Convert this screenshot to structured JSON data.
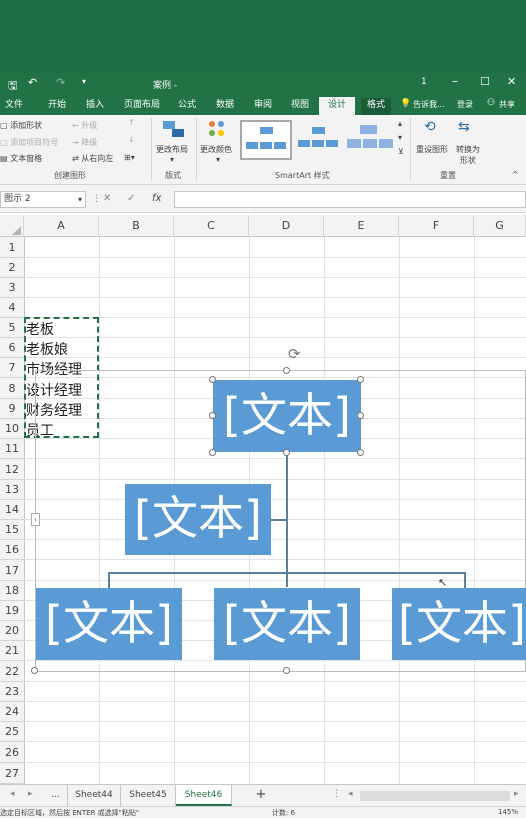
{
  "title_bar": {
    "save_icon": "save-icon",
    "undo_icon": "undo-icon",
    "redo_icon": "redo-icon",
    "filename": "案例 -",
    "account_number": "1",
    "minimize_icon": "minimize-icon",
    "maximize_icon": "maximize-icon",
    "close_icon": "close-icon"
  },
  "tabs": [
    "文件",
    "开始",
    "插入",
    "页面布局",
    "公式",
    "数据",
    "审阅",
    "视图",
    "设计",
    "格式"
  ],
  "active_tab": "设计",
  "tell_me": "告诉我...",
  "login": "登录",
  "share": "共享",
  "ribbon": {
    "create_graphic": {
      "add_shape": "添加形状",
      "add_bullet": "添加项目符号",
      "text_pane": "文本窗格",
      "promote": "升级",
      "demote": "降级",
      "right_to_left": "从右向左",
      "label": "创建图形"
    },
    "layouts": {
      "change_layout": "更改布局",
      "label": "版式"
    },
    "styles": {
      "change_colors": "更改颜色",
      "label": "SmartArt 样式"
    },
    "reset": {
      "reset_graphic": "重设图形",
      "convert": "转换为",
      "convert2": "形状",
      "label": "重置"
    }
  },
  "formula_bar": {
    "name_box": "图示 2",
    "cancel": "✕",
    "enter": "✓",
    "fx": "fx"
  },
  "columns": [
    "A",
    "B",
    "C",
    "D",
    "E",
    "F",
    "G"
  ],
  "rows": [
    "1",
    "2",
    "3",
    "4",
    "5",
    "6",
    "7",
    "8",
    "9",
    "10",
    "11",
    "12",
    "13",
    "14",
    "15",
    "16",
    "17",
    "18",
    "19",
    "20",
    "21",
    "22",
    "23",
    "24",
    "25",
    "26",
    "27"
  ],
  "cells_A": [
    "老板",
    "老板娘",
    "市场经理",
    "设计经理",
    "财务经理",
    "员工"
  ],
  "smartart": {
    "top": "[文本]",
    "assistant": "[文本]",
    "bottom": [
      "[文本]",
      "[文本]",
      "[文本]"
    ]
  },
  "sheets": {
    "ellipsis": "...",
    "tabs": [
      "Sheet44",
      "Sheet45",
      "Sheet46"
    ],
    "active": "Sheet46",
    "add": "+"
  },
  "status": {
    "message": "选定目标区域，然后按 ENTER 或选择\"粘贴\"",
    "count_label": "计数: 6",
    "zoom": "145%"
  },
  "colors": {
    "excel_green": "#217346",
    "smartart_blue": "#5b9bd5"
  }
}
